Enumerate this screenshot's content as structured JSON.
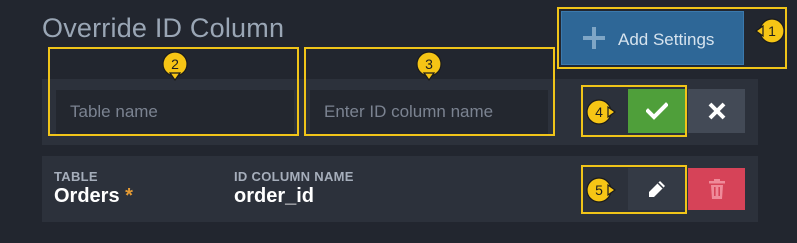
{
  "page": {
    "title": "Override ID Column"
  },
  "toolbar": {
    "add_settings_label": "Add Settings",
    "add_settings_icon": "plus-icon"
  },
  "form": {
    "table_name": {
      "placeholder": "Table name",
      "value": ""
    },
    "id_column": {
      "placeholder": "Enter ID column name",
      "value": ""
    },
    "confirm_icon": "check-icon",
    "cancel_icon": "close-icon"
  },
  "rows": [
    {
      "table_label": "TABLE",
      "table_value": "Orders",
      "required_marker": "*",
      "id_column_label": "ID COLUMN NAME",
      "id_column_value": "order_id",
      "edit_icon": "pencil-icon",
      "delete_icon": "trash-icon"
    }
  ],
  "annotations": [
    "1",
    "2",
    "3",
    "4",
    "5"
  ],
  "colors": {
    "background": "#22262f",
    "panel": "#2c313b",
    "primary": "#2e6797",
    "success": "#4f9f3a",
    "danger": "#d64358",
    "highlight": "#f0c419",
    "required": "#e49a34"
  }
}
